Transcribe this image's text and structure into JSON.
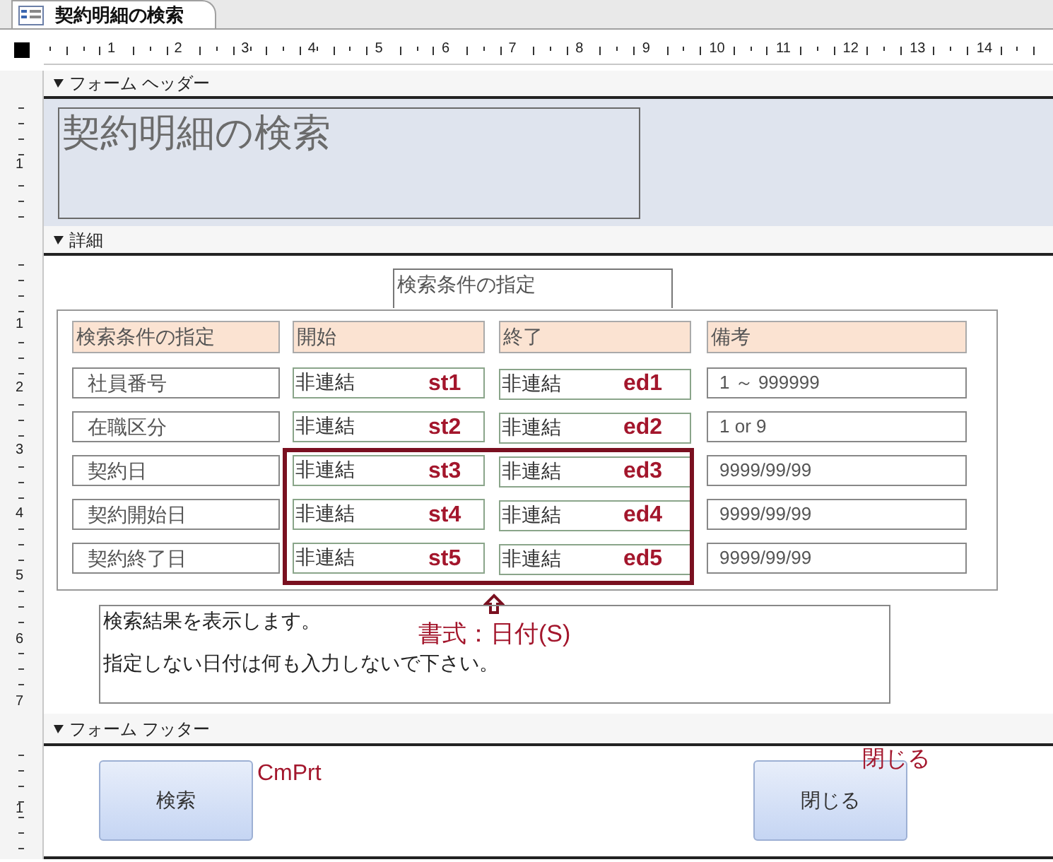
{
  "tab": {
    "title": "契約明細の検索"
  },
  "ruler": {
    "marks": [
      "1",
      "2",
      "3",
      "4",
      "5",
      "6",
      "7",
      "8",
      "9",
      "10",
      "11",
      "12",
      "13",
      "14"
    ]
  },
  "header": {
    "label": "フォーム ヘッダー",
    "ruler_marks": [
      "1"
    ],
    "title": "契約明細の検索"
  },
  "detail": {
    "label": "詳細",
    "ruler_marks": [
      "1",
      "2",
      "3",
      "4",
      "5",
      "6",
      "7"
    ],
    "caption": "検索条件の指定",
    "columns": [
      "検索条件の指定",
      "開始",
      "終了",
      "備考"
    ],
    "rows": [
      {
        "label": "社員番号",
        "start": "非連結",
        "start_name": "st1",
        "end": "非連結",
        "end_name": "ed1",
        "note": "1 ～ 999999",
        "highlighted": false
      },
      {
        "label": "在職区分",
        "start": "非連結",
        "start_name": "st2",
        "end": "非連結",
        "end_name": "ed2",
        "note": "1 or 9",
        "highlighted": false
      },
      {
        "label": "契約日",
        "start": "非連結",
        "start_name": "st3",
        "end": "非連結",
        "end_name": "ed3",
        "note": "9999/99/99",
        "highlighted": true
      },
      {
        "label": "契約開始日",
        "start": "非連結",
        "start_name": "st4",
        "end": "非連結",
        "end_name": "ed4",
        "note": "9999/99/99",
        "highlighted": true
      },
      {
        "label": "契約終了日",
        "start": "非連結",
        "start_name": "st5",
        "end": "非連結",
        "end_name": "ed5",
        "note": "9999/99/99",
        "highlighted": true
      }
    ],
    "format_note": "書式：日付(S)",
    "message": [
      "検索結果を表示します。",
      "指定しない日付は何も入力しないで下さい。"
    ]
  },
  "footer": {
    "label": "フォーム フッター",
    "ruler_marks": [
      "1"
    ],
    "buttons": [
      {
        "label": "検索",
        "annotation": "CmPrt"
      },
      {
        "label": "閉じる",
        "annotation": "閉じる"
      }
    ]
  }
}
